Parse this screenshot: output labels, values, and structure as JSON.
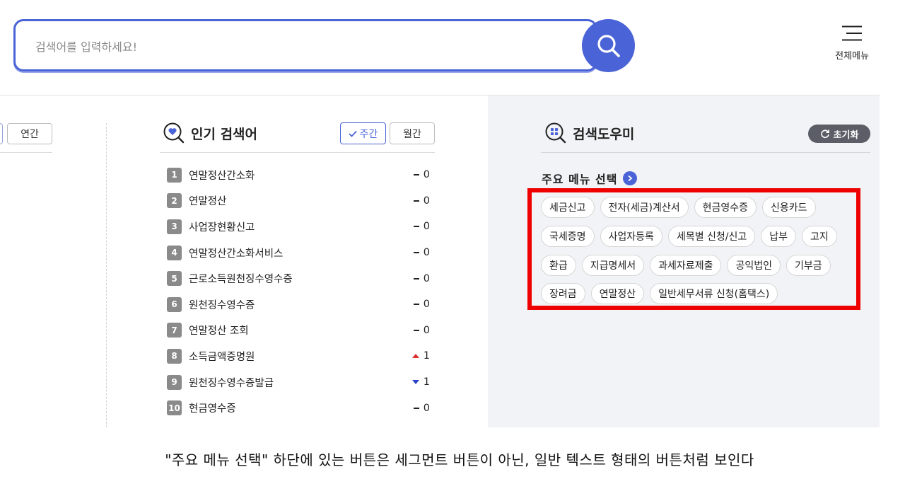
{
  "search": {
    "placeholder": "검색어를 입력하세요!"
  },
  "header": {
    "menu_label": "전체메뉴"
  },
  "left_panel": {
    "yearly_label": "연간"
  },
  "popular": {
    "title": "인기 검색어",
    "tab_weekly": "주간",
    "tab_monthly": "월간",
    "items": [
      {
        "rank": "1",
        "term": "연말정산간소화",
        "change": "0",
        "trend": "same"
      },
      {
        "rank": "2",
        "term": "연말정산",
        "change": "0",
        "trend": "same"
      },
      {
        "rank": "3",
        "term": "사업장현황신고",
        "change": "0",
        "trend": "same"
      },
      {
        "rank": "4",
        "term": "연말정산간소화서비스",
        "change": "0",
        "trend": "same"
      },
      {
        "rank": "5",
        "term": "근로소득원천징수영수증",
        "change": "0",
        "trend": "same"
      },
      {
        "rank": "6",
        "term": "원천징수영수증",
        "change": "0",
        "trend": "same"
      },
      {
        "rank": "7",
        "term": "연말정산 조회",
        "change": "0",
        "trend": "same"
      },
      {
        "rank": "8",
        "term": "소득금액증명원",
        "change": "1",
        "trend": "up"
      },
      {
        "rank": "9",
        "term": "원천징수영수증발급",
        "change": "1",
        "trend": "down"
      },
      {
        "rank": "10",
        "term": "현금영수증",
        "change": "0",
        "trend": "same"
      }
    ]
  },
  "helper": {
    "title": "검색도우미",
    "reset_label": "초기화",
    "main_menu_title": "주요 메뉴 선택",
    "chip_rows": [
      [
        "세금신고",
        "전자(세금)계산서",
        "현금영수증",
        "신용카드"
      ],
      [
        "국세증명",
        "사업자등록",
        "세목별 신청/신고",
        "납부",
        "고지"
      ],
      [
        "환급",
        "지급명세서",
        "과세자료제출",
        "공익법인",
        "기부금"
      ],
      [
        "장려금",
        "연말정산",
        "일반세무서류 신청(홈택스)"
      ]
    ]
  },
  "caption": "\"주요 메뉴 선택\" 하단에 있는 버튼은 세그먼트 버튼이 아닌, 일반 텍스트 형태의 버튼처럼 보인다",
  "colors": {
    "accent": "#4a63d6",
    "highlight": "#ee0000",
    "up": "#d9322f",
    "down": "#2c43c9"
  }
}
